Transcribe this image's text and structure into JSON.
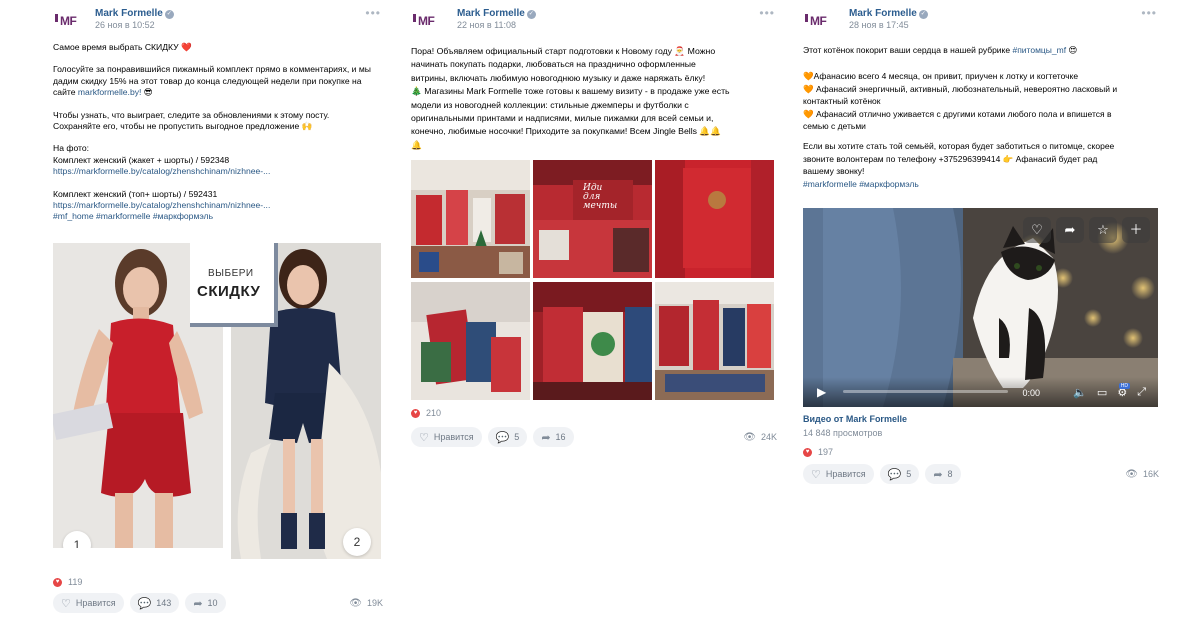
{
  "posts": [
    {
      "author": "Mark Formelle",
      "date": "26 ноя в 10:52",
      "logo_text": "MF",
      "text": {
        "line1": "Самое время выбрать СКИДКУ ❤️",
        "para2": "Голосуйте за понравившийся пижамный комплект прямо в комментариях, и мы\nдадим скидку 15% на этот товар до конца следующей недели при покупке на\nсайте ",
        "para2_link": "markformelle.by!",
        "para2_end": " 😎",
        "para3": "Чтобы узнать, что выиграет, следите за обновлениями к этому посту.\nСохраняйте его, чтобы не пропустить выгодное предложение 🙌",
        "photo_label": "На фото:",
        "item1": "Комплект женский (жакет + шорты) / 592348",
        "item1_link": "https://markformelle.by/catalog/zhenshchinam/nizhnee-...",
        "item2": "Комплект женский (топ+ шорты) / 592431",
        "item2_link": "https://markformelle.by/catalog/zhenshchinam/nizhnee-...",
        "hashtags": "#mf_home #markformelle #маркформэль"
      },
      "promo": {
        "line1": "ВЫБЕРИ",
        "line2": "СКИДКУ"
      },
      "badges": [
        "1",
        "2"
      ],
      "likes": "119",
      "actions": {
        "like": "Нравится",
        "comments": "143",
        "shares": "10"
      },
      "views": "19K"
    },
    {
      "author": "Mark Formelle",
      "date": "22 ноя в 11:08",
      "logo_text": "MF",
      "text": "Пора! Объявляем официальный старт подготовки к Новому году 🎅 Можно\nначинать покупать подарки, любоваться на празднично оформленные\nвитрины, включать любимую новогоднюю музыку и даже наряжать ёлку!\n🎄 Магазины Mark Formelle тоже готовы к вашему визиту - в продаже уже есть\nмодели из новогодней коллекции: стильные джемперы и футболки с\nоригинальными принтами и надписями, милые пижамки для всей семьи и,\nконечно, любимые носочки! Приходите за покупками! Всем Jingle Bells 🔔🔔\n🔔",
      "photo_caption": "Иди\nдля\nмечты",
      "likes": "210",
      "actions": {
        "like": "Нравится",
        "comments": "5",
        "shares": "16"
      },
      "views": "24K"
    },
    {
      "author": "Mark Formelle",
      "date": "28 ноя в 17:45",
      "logo_text": "MF",
      "text": {
        "intro": "Этот котёнок покорит ваши сердца в нашей рубрике ",
        "intro_tag": "#питомцы_mf",
        "intro_end": " 😍",
        "b1": "🧡Афанасию всего 4 месяца, он привит, приучен к лотку и когтеточке",
        "b2": "🧡 Афанасий энергичный, активный, любознательный, невероятно ласковый и\nконтактный котёнок",
        "b3": "🧡 Афанасий отлично уживается с другими котами любого пола и впишется в\nсемью с детьми",
        "family": "Если вы хотите стать той семьёй, которая будет заботиться о питомце, скорее\nзвоните волонтерам по телефону +375296399414 👉 Афанасий будет рад\nвашему звонку!",
        "hashtags": "#markformelle #маркформэль"
      },
      "video": {
        "time": "0:00",
        "hd": "HD",
        "title": "Видео от Mark Formelle",
        "views": "14 848 просмотров"
      },
      "likes": "197",
      "actions": {
        "like": "Нравится",
        "comments": "5",
        "shares": "8"
      },
      "views": "16K"
    }
  ],
  "colors": {
    "link": "#2a5885",
    "author": "#2c5d8f",
    "meta": "#818c99",
    "heart": "#e64646",
    "button_bg": "#f0f2f5",
    "brand": "#6a2b6c"
  },
  "icons": {
    "more": "more-dots-icon",
    "verified": "verified-icon",
    "heart": "heart-icon",
    "comment": "comment-icon",
    "share": "share-icon",
    "eye": "eye-icon"
  }
}
